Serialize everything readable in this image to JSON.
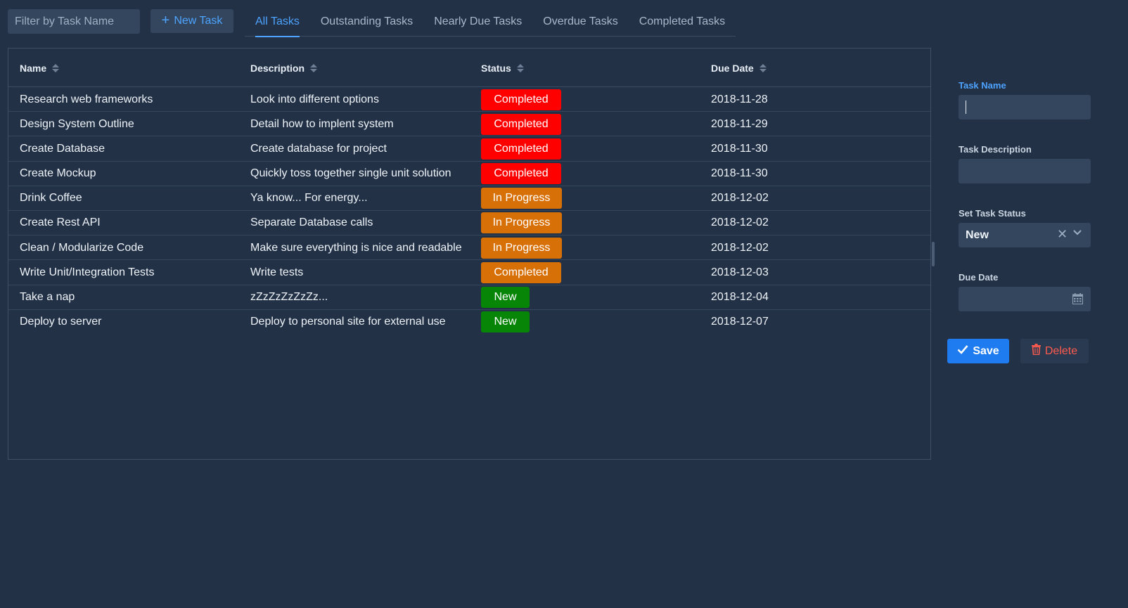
{
  "toolbar": {
    "filter_placeholder": "Filter by Task Name",
    "new_task_label": "New Task",
    "new_task_icon": "plus-icon"
  },
  "tabs": [
    {
      "label": "All Tasks",
      "active": true
    },
    {
      "label": "Outstanding Tasks",
      "active": false
    },
    {
      "label": "Nearly Due Tasks",
      "active": false
    },
    {
      "label": "Overdue Tasks",
      "active": false
    },
    {
      "label": "Completed Tasks",
      "active": false
    }
  ],
  "table": {
    "columns": [
      "Name",
      "Description",
      "Status",
      "Due Date"
    ],
    "rows": [
      {
        "name": "Research web frameworks",
        "description": "Look into different options",
        "status": "Completed",
        "status_color": "#ff0000",
        "due": "2018-11-28"
      },
      {
        "name": "Design System Outline",
        "description": "Detail how to implent system",
        "status": "Completed",
        "status_color": "#ff0000",
        "due": "2018-11-29"
      },
      {
        "name": "Create Database",
        "description": "Create database for project",
        "status": "Completed",
        "status_color": "#ff0000",
        "due": "2018-11-30"
      },
      {
        "name": "Create Mockup",
        "description": "Quickly toss together single unit solution",
        "status": "Completed",
        "status_color": "#ff0000",
        "due": "2018-11-30"
      },
      {
        "name": "Drink Coffee",
        "description": "Ya know... For energy...",
        "status": "In Progress",
        "status_color": "#d87008",
        "due": "2018-12-02"
      },
      {
        "name": "Create Rest API",
        "description": "Separate Database calls",
        "status": "In Progress",
        "status_color": "#d87008",
        "due": "2018-12-02"
      },
      {
        "name": "Clean / Modularize Code",
        "description": "Make sure everything is nice and readable",
        "status": "In Progress",
        "status_color": "#d87008",
        "due": "2018-12-02"
      },
      {
        "name": "Write Unit/Integration Tests",
        "description": "Write tests",
        "status": "Completed",
        "status_color": "#d87008",
        "due": "2018-12-03"
      },
      {
        "name": "Take a nap",
        "description": "zZzZzZzZzZz...",
        "status": "New",
        "status_color": "#078507",
        "due": "2018-12-04"
      },
      {
        "name": "Deploy to server",
        "description": "Deploy to personal site for external use",
        "status": "New",
        "status_color": "#078507",
        "due": "2018-12-07"
      }
    ]
  },
  "form": {
    "task_name_label": "Task Name",
    "task_name_value": "",
    "task_description_label": "Task Description",
    "task_description_value": "",
    "status_label": "Set Task Status",
    "status_value": "New",
    "due_date_label": "Due Date",
    "due_date_value": "",
    "save_label": "Save",
    "delete_label": "Delete"
  },
  "colors": {
    "background": "#223146",
    "accent": "#4da3ff",
    "primary_button": "#1f7cf0",
    "danger_text": "#ff5a4e",
    "status_red": "#ff0000",
    "status_orange": "#d87008",
    "status_green": "#078507"
  }
}
